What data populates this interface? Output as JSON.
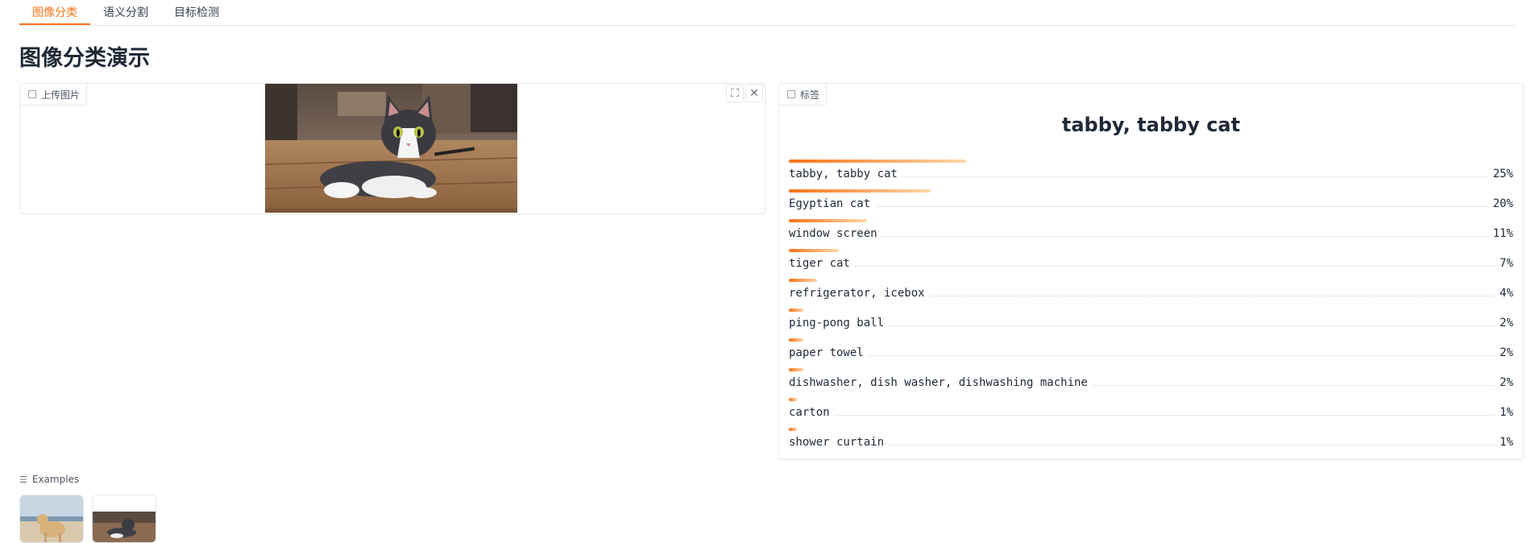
{
  "tabs": [
    {
      "label": "图像分类",
      "active": true
    },
    {
      "label": "语义分割",
      "active": false
    },
    {
      "label": "目标检测",
      "active": false
    }
  ],
  "page_title": "图像分类演示",
  "input_panel": {
    "label": "上传图片",
    "label_icon": "image-icon",
    "buttons": {
      "fullscreen_icon": "fullscreen-icon",
      "close_icon": "close-icon"
    }
  },
  "output_panel": {
    "label": "标签",
    "label_icon": "label-icon",
    "top_prediction": "tabby, tabby cat",
    "predictions": [
      {
        "label": "tabby, tabby cat",
        "pct": "25%",
        "confidence": 0.25
      },
      {
        "label": "Egyptian cat",
        "pct": "20%",
        "confidence": 0.2
      },
      {
        "label": "window screen",
        "pct": "11%",
        "confidence": 0.11
      },
      {
        "label": "tiger cat",
        "pct": "7%",
        "confidence": 0.07
      },
      {
        "label": "refrigerator, icebox",
        "pct": "4%",
        "confidence": 0.04
      },
      {
        "label": "ping-pong ball",
        "pct": "2%",
        "confidence": 0.02
      },
      {
        "label": "paper towel",
        "pct": "2%",
        "confidence": 0.02
      },
      {
        "label": "dishwasher, dish washer, dishwashing machine",
        "pct": "2%",
        "confidence": 0.02
      },
      {
        "label": "carton",
        "pct": "1%",
        "confidence": 0.01
      },
      {
        "label": "shower curtain",
        "pct": "1%",
        "confidence": 0.01
      }
    ]
  },
  "examples": {
    "label": "Examples",
    "icon": "list-icon"
  },
  "colors": {
    "accent": "#f97316",
    "bar_end": "#fed7aa",
    "border": "#e5e7eb"
  }
}
